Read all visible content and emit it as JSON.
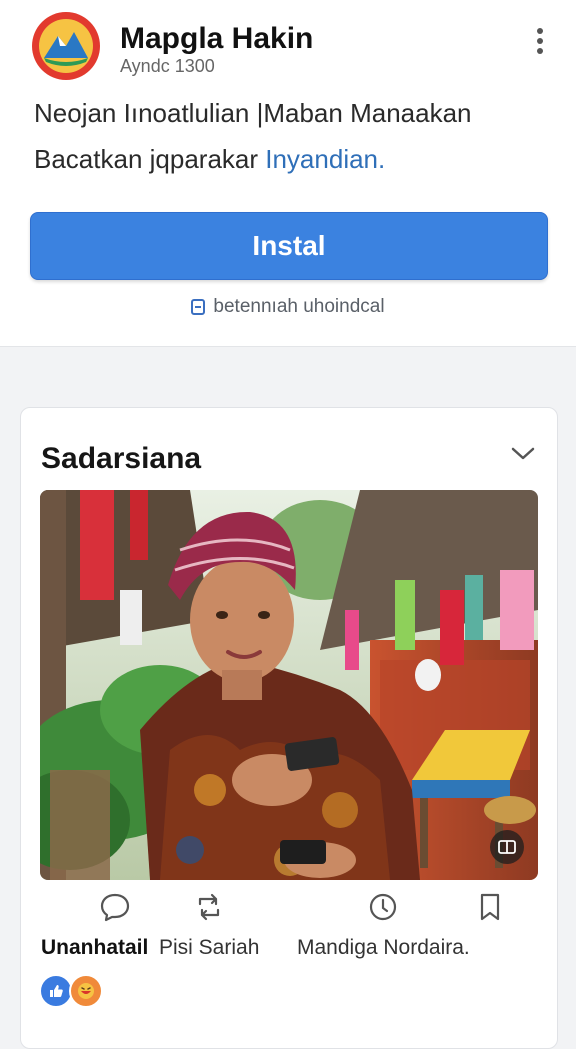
{
  "app": {
    "name": "Mapgla Hakin",
    "subtitle": "Ayndc 1300"
  },
  "description": {
    "line1": "Neojan Iınoatlulian |Maban Manaakan",
    "line2_prefix": "Bacatkan jqparakar ",
    "line2_link": "Inyandian."
  },
  "install": {
    "button_label": "Instal",
    "note": "betennıah uhoindcal"
  },
  "card": {
    "title": "Sadarsiana",
    "actions": [
      {
        "icon": "comment-icon",
        "label": "Unanhatail"
      },
      {
        "icon": "repost-icon",
        "label": "Pisi Sariah"
      },
      {
        "icon": "share-icon",
        "label": "Mandiga Nordaira."
      },
      {
        "icon": "bookmark-icon",
        "label": ""
      }
    ],
    "reactions": [
      "like-icon",
      "laugh-icon"
    ]
  },
  "colors": {
    "accent": "#3b82e0",
    "link": "#2f6fb8",
    "like": "#3a7be0",
    "laugh": "#f08a3a"
  }
}
